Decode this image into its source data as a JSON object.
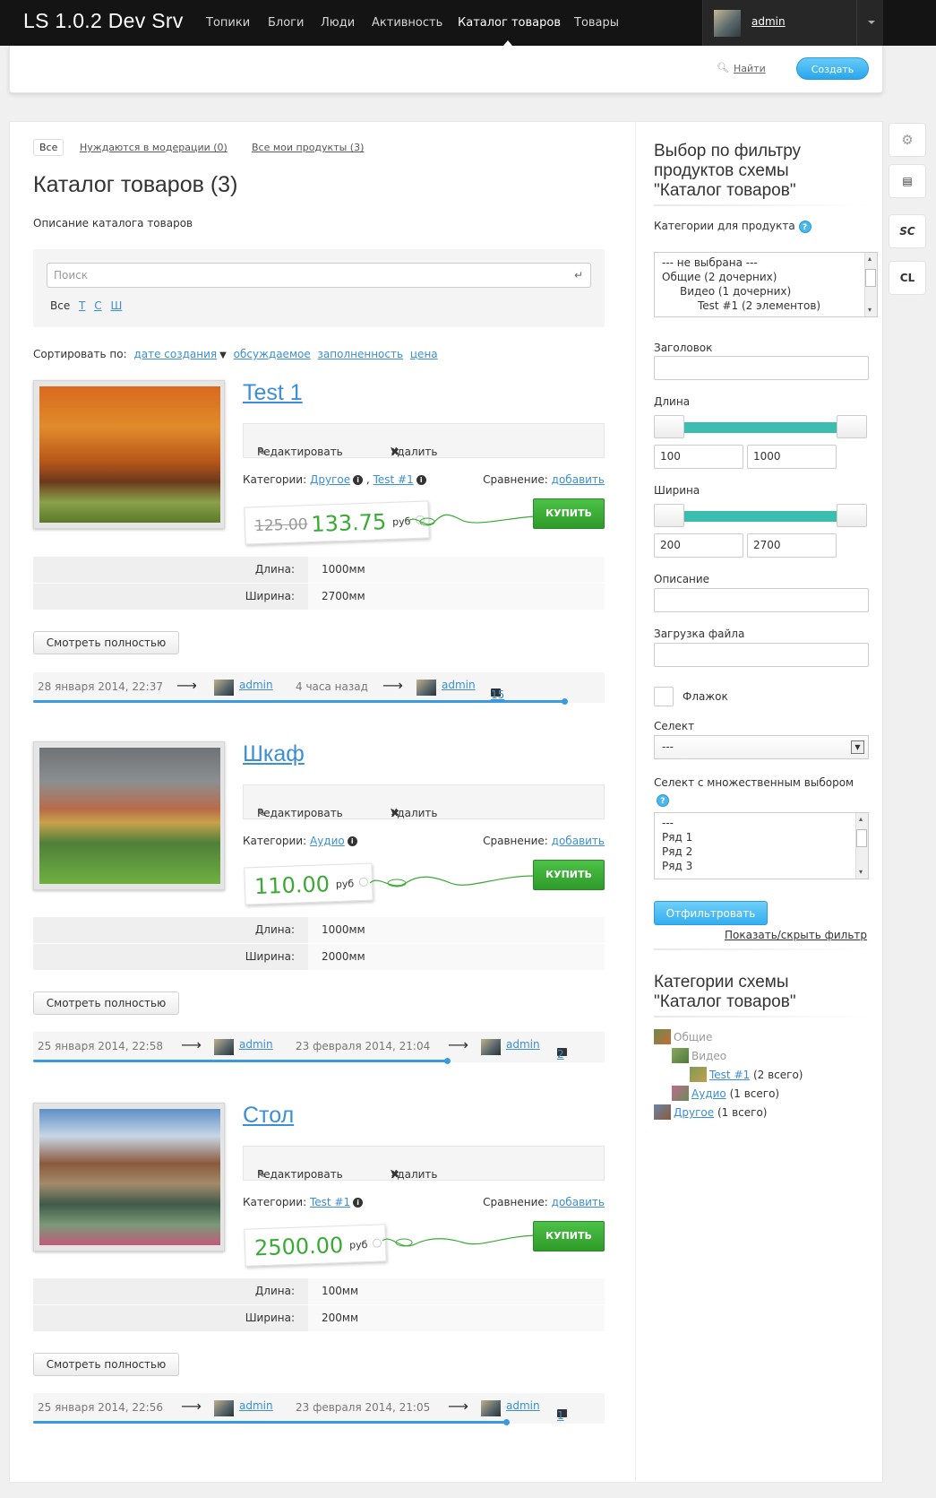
{
  "header": {
    "logo": "LS 1.0.2 Dev Srv",
    "nav": [
      "Топики",
      "Блоги",
      "Люди",
      "Активность",
      "Каталог товаров",
      "Товары"
    ],
    "active_nav": "Каталог товаров",
    "username": "admin",
    "search_label": "Найти",
    "create_label": "Создать"
  },
  "filters": {
    "all": "Все",
    "moderation": "Нуждаются в модерации (0)",
    "mine": "Все мои продукты (3)"
  },
  "page": {
    "title": "Каталог товаров (3)",
    "description": "Описание каталога товаров",
    "search_placeholder": "Поиск",
    "enter_glyph": "↵",
    "letters": [
      "Все",
      "Т",
      "С",
      "Ш"
    ],
    "sort_label": "Сортировать по:",
    "sort_options": [
      "дате создания",
      "обсуждаемое",
      "заполненность",
      "цена"
    ]
  },
  "labels": {
    "edit": "Редактировать",
    "delete": "Удалить",
    "categories": "Категории:",
    "compare": "Сравнение:",
    "compare_add": "добавить",
    "buy": "КУПИТЬ",
    "rub": "руб",
    "view_full": "Смотреть полностью",
    "length": "Длина:",
    "width": "Ширина:",
    "arrow": "⟶"
  },
  "products": [
    {
      "title": "Test 1",
      "categories": [
        "Другое",
        "Test #1"
      ],
      "old_price": "125.00",
      "price": "133.75",
      "length": "1000мм",
      "width": "2700мм",
      "created": "28 января 2014, 22:37",
      "author": "admin",
      "updated": "4 часа назад",
      "editor": "admin",
      "comments": "15",
      "progress": 1.0
    },
    {
      "title": "Шкаф",
      "categories": [
        "Аудио"
      ],
      "old_price": "",
      "price": "110.00",
      "length": "1000мм",
      "width": "2000мм",
      "created": "25 января 2014, 22:58",
      "author": "admin",
      "updated": "23 февраля 2014, 21:04",
      "editor": "admin",
      "comments": "2",
      "progress": 0.78
    },
    {
      "title": "Стол",
      "categories": [
        "Test #1"
      ],
      "old_price": "",
      "price": "2500.00",
      "length": "100мм",
      "width": "200мм",
      "created": "25 января 2014, 22:56",
      "author": "admin",
      "updated": "23 февраля 2014, 21:05",
      "editor": "admin",
      "comments": "1",
      "progress": 0.89
    }
  ],
  "sidebar": {
    "filter_title": "Выбор по фильтру продуктов схемы \"Каталог товаров\"",
    "categories_label": "Категории для продукта",
    "category_options": [
      "--- не выбрана ---",
      "Общие (2 дочерних)",
      "Видео (1 дочерних)",
      "Test #1 (2 элементов)"
    ],
    "heading_label": "Заголовок",
    "length_label": "Длина",
    "length_min": "100",
    "length_max": "1000",
    "width_label": "Ширина",
    "width_min": "200",
    "width_max": "2700",
    "description_label": "Описание",
    "upload_label": "Загрузка файла",
    "checkbox_label": "Флажок",
    "select_label": "Селект",
    "select_value": "---",
    "multiselect_label": "Селект с множественным выбором",
    "multiselect_options": [
      "---",
      "Ряд 1",
      "Ряд 2",
      "Ряд 3"
    ],
    "filter_button": "Отфильтровать",
    "toggle_filter": "Показать/скрыть фильтр",
    "tree_title": "Категории схемы \"Каталог товаров\"",
    "tree": [
      {
        "label": "Общие",
        "count": ""
      },
      {
        "label": "Видео",
        "count": ""
      },
      {
        "label": "Test #1",
        "count": "(2 всего)"
      },
      {
        "label": "Аудио",
        "count": "(1 всего)"
      },
      {
        "label": "Другое",
        "count": "(1 всего)"
      }
    ]
  },
  "toolbar": {
    "gear": "⚙",
    "doc": "▤",
    "sc": "SC",
    "cl": "CL"
  }
}
